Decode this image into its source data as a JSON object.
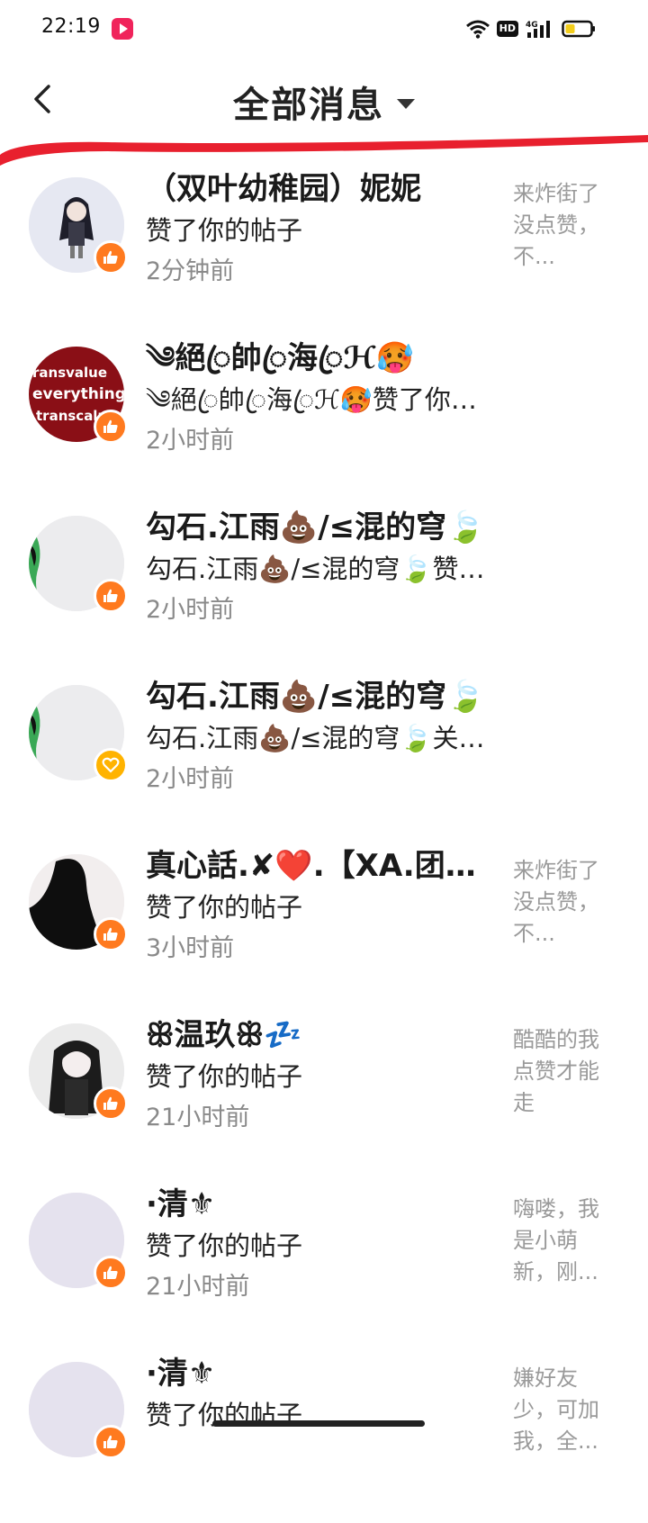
{
  "status_bar": {
    "time": "22:19",
    "hd": "HD",
    "network": "4G"
  },
  "header": {
    "title": "全部消息",
    "back_icon": "chevron-left-icon",
    "dropdown_icon": "caret-down-icon"
  },
  "accent_colors": {
    "underline_red": "#e8202e",
    "like_badge": "#ff7a1f",
    "heart_badge": "#ffb300"
  },
  "messages": [
    {
      "name": "（双叶幼稚园）妮妮",
      "action": "赞了你的帖子",
      "time": "2分钟前",
      "preview": "来炸街了没点赞，不...",
      "badge": "like"
    },
    {
      "name": "༄絕ꦿ帥ꦿ海ꦿℋ🥵",
      "action": "༄絕ꦿ帥ꦿ海ꦿℋ🥵赞了你的帖子",
      "time": "2小时前",
      "preview": "",
      "badge": "like"
    },
    {
      "name": "勾石.江雨💩/≤混的穹🍃",
      "action": "勾石.江雨💩/≤混的穹🍃赞了你的帖子",
      "time": "2小时前",
      "preview": "",
      "badge": "like"
    },
    {
      "name": "勾石.江雨💩/≤混的穹🍃",
      "action": "勾石.江雨💩/≤混的穹🍃关注了你",
      "time": "2小时前",
      "preview": "",
      "badge": "heart"
    },
    {
      "name": "真心話.✘❤️.【XA.团队】",
      "action": "赞了你的帖子",
      "time": "3小时前",
      "preview": "来炸街了没点赞，不...",
      "badge": "like"
    },
    {
      "name": "ꕥ温玖ꕥ💤",
      "action": "赞了你的帖子",
      "time": "21小时前",
      "preview": "酷酷的我点赞才能走",
      "badge": "like"
    },
    {
      "name": "·清⚜",
      "action": "赞了你的帖子",
      "time": "21小时前",
      "preview": "嗨喽，我是小萌新，刚...",
      "badge": "like"
    },
    {
      "name": "·清⚜",
      "action": "赞了你的帖子",
      "time": "",
      "preview": "嫌好友少，可加我，全...",
      "badge": "like"
    }
  ]
}
